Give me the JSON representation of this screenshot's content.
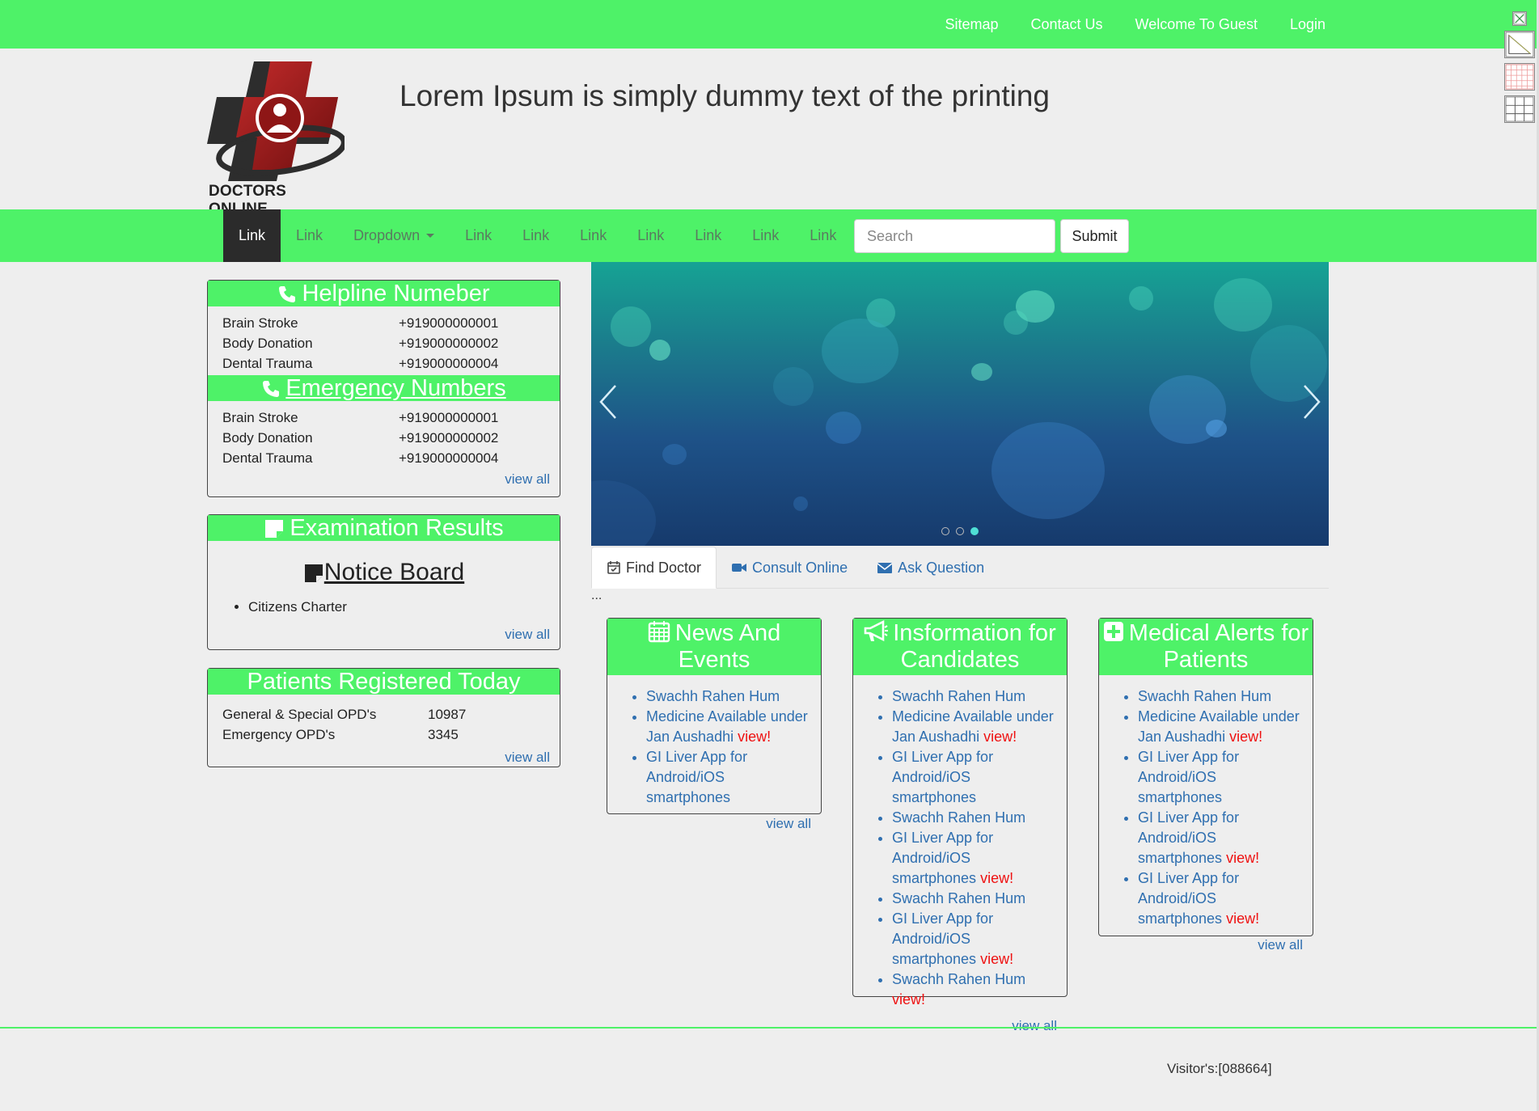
{
  "topbar": {
    "links": [
      "Sitemap",
      "Contact Us",
      "Welcome To Guest",
      "Login"
    ]
  },
  "header": {
    "logo_text": "DOCTORS ONLINE",
    "tagline": "Lorem Ipsum is simply dummy text of the printing"
  },
  "nav": {
    "items": [
      "Link",
      "Link",
      "Dropdown",
      "Link",
      "Link",
      "Link",
      "Link",
      "Link",
      "Link",
      "Link"
    ],
    "active_index": 0,
    "search_placeholder": "Search",
    "submit_label": "Submit"
  },
  "helpline": {
    "title": "Helpline Numeber",
    "rows": [
      {
        "name": "Brain Stroke",
        "number": "+919000000001"
      },
      {
        "name": "Body Donation",
        "number": "+919000000002"
      },
      {
        "name": "Dental Trauma",
        "number": "+919000000004"
      }
    ]
  },
  "emergency": {
    "title": "Emergency Numbers",
    "rows": [
      {
        "name": "Brain Stroke",
        "number": "+919000000001"
      },
      {
        "name": "Body Donation",
        "number": "+919000000002"
      },
      {
        "name": "Dental Trauma",
        "number": "+919000000004"
      }
    ],
    "view_all": "view all"
  },
  "exam": {
    "title": "Examination Results",
    "notice_title": "Notice Board",
    "items": [
      "Citizens Charter"
    ],
    "view_all": "view all"
  },
  "patients": {
    "title": "Patients Registered Today",
    "rows": [
      {
        "name": "General & Special OPD's",
        "count": "10987"
      },
      {
        "name": "Emergency OPD's",
        "count": "3345"
      }
    ],
    "view_all": "view all"
  },
  "carousel": {
    "slide_count": 3,
    "active_slide": 2
  },
  "tabs": [
    {
      "label": "Find Doctor",
      "icon": "calendar-check-icon",
      "active": true
    },
    {
      "label": "Consult Online",
      "icon": "video-camera-icon",
      "active": false
    },
    {
      "label": "Ask Question",
      "icon": "envelope-icon",
      "active": false
    }
  ],
  "tab_content": "...",
  "news": {
    "title": "News And Events",
    "items": [
      {
        "text": "Swachh Rahen Hum",
        "badge": ""
      },
      {
        "text": "Medicine Available under Jan Aushadhi",
        "badge": "view!"
      },
      {
        "text": "GI Liver App for Android/iOS smartphones",
        "badge": ""
      }
    ],
    "view_all": "view all"
  },
  "candidates": {
    "title": "Insformation for Candidates",
    "items": [
      {
        "text": "Swachh Rahen Hum",
        "badge": ""
      },
      {
        "text": "Medicine Available under Jan Aushadhi",
        "badge": "view!"
      },
      {
        "text": "GI Liver App for Android/iOS smartphones",
        "badge": ""
      },
      {
        "text": "Swachh Rahen Hum",
        "badge": ""
      },
      {
        "text": "GI Liver App for Android/iOS smartphones",
        "badge": "view!"
      },
      {
        "text": "Swachh Rahen Hum",
        "badge": ""
      },
      {
        "text": "GI Liver App for Android/iOS smartphones",
        "badge": "view!"
      },
      {
        "text": "Swachh Rahen Hum",
        "badge": "view!"
      }
    ],
    "view_all": "view all"
  },
  "alerts": {
    "title": "Medical Alerts for Patients",
    "items": [
      {
        "text": "Swachh Rahen Hum",
        "badge": ""
      },
      {
        "text": "Medicine Available under Jan Aushadhi",
        "badge": "view!"
      },
      {
        "text": "GI Liver App for Android/iOS smartphones",
        "badge": ""
      },
      {
        "text": "GI Liver App for Android/iOS smartphones",
        "badge": "view!"
      },
      {
        "text": "GI Liver App for Android/iOS smartphones",
        "badge": "view!"
      }
    ],
    "view_all": "view all"
  },
  "footer": {
    "visitor": "Visitor's:[088664]"
  },
  "colors": {
    "brand_green": "#4ef268",
    "link_blue": "#2f6fb0",
    "alert_red": "#e11111",
    "logo_red": "#9e1b1b"
  }
}
